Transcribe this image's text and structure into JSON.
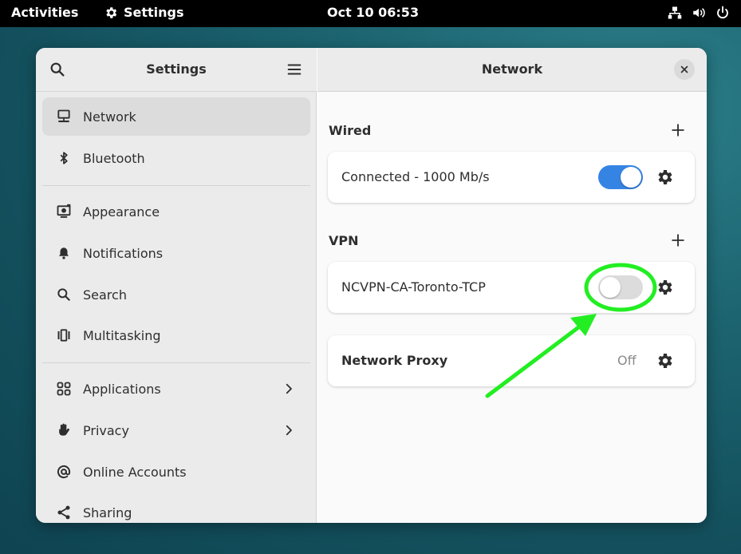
{
  "topbar": {
    "activities": "Activities",
    "app_name": "Settings",
    "clock": "Oct 10  06:53"
  },
  "sidebar": {
    "title": "Settings",
    "items": [
      {
        "label": "Network",
        "icon": "network-wired-icon"
      },
      {
        "label": "Bluetooth",
        "icon": "bluetooth-icon"
      },
      {
        "label": "Appearance",
        "icon": "appearance-icon"
      },
      {
        "label": "Notifications",
        "icon": "bell-icon"
      },
      {
        "label": "Search",
        "icon": "search-icon"
      },
      {
        "label": "Multitasking",
        "icon": "multitasking-icon"
      },
      {
        "label": "Applications",
        "icon": "grid-icon"
      },
      {
        "label": "Privacy",
        "icon": "hand-icon"
      },
      {
        "label": "Online Accounts",
        "icon": "at-icon"
      },
      {
        "label": "Sharing",
        "icon": "share-icon"
      }
    ]
  },
  "content": {
    "title": "Network",
    "wired": {
      "title": "Wired",
      "connection": "Connected - 1000 Mb/s",
      "enabled": true
    },
    "vpn": {
      "title": "VPN",
      "connection": "NCVPN-CA-Toronto-TCP",
      "enabled": false
    },
    "proxy": {
      "label": "Network Proxy",
      "status": "Off"
    }
  },
  "colors": {
    "accent": "#3584e4",
    "annotation": "#22ee22",
    "topbar": "#000000"
  }
}
